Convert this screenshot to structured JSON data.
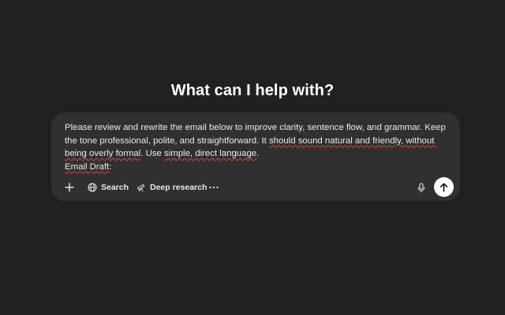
{
  "heading": "What can I help with?",
  "composer": {
    "text_segments": [
      {
        "text": "Please review and rewrite the email below to improve clarity, sentence flow, and grammar. Keep the tone professional, polite, and straightforward. It ",
        "spell": false
      },
      {
        "text": "should sound natural and friendly, without being overly formal",
        "spell": true
      },
      {
        "text": ". Use ",
        "spell": false
      },
      {
        "text": "simple, direct language",
        "spell": true
      },
      {
        "text": ".\n",
        "spell": false
      },
      {
        "text": "Email Draft",
        "spell": true
      },
      {
        "text": ":",
        "spell": false
      }
    ]
  },
  "toolbar": {
    "add_icon": "plus-icon",
    "search_label": "Search",
    "search_icon": "globe-icon",
    "deep_research_label": "Deep research",
    "deep_research_icon": "telescope-icon",
    "more_icon": "ellipsis-icon",
    "mic_icon": "microphone-icon",
    "send_icon": "arrow-up-icon"
  },
  "colors": {
    "background": "#212121",
    "composer": "#303030",
    "spellcheck_underline": "#e0443e",
    "send_button": "#ffffff"
  }
}
